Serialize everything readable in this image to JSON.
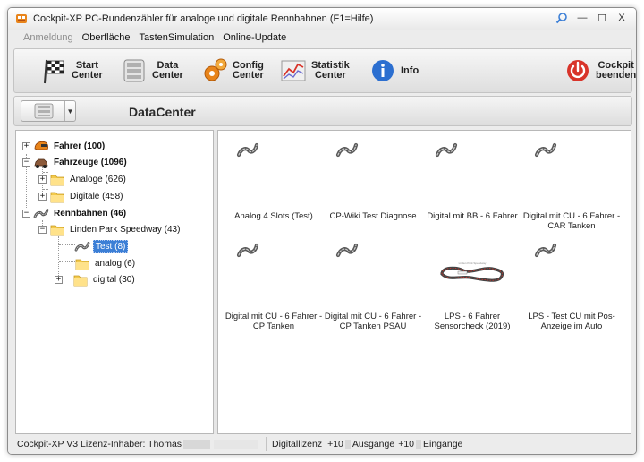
{
  "window": {
    "title": "Cockpit-XP PC-Rundenzähler für analoge und digitale Rennbahnen (F1=Hilfe)",
    "controls": {
      "minimize": "—",
      "maximize": "☐",
      "close": "X"
    }
  },
  "menu": [
    {
      "label": "Anmeldung",
      "disabled": true
    },
    {
      "label": "Oberfläche",
      "disabled": false
    },
    {
      "label": "TastenSimulation",
      "disabled": false
    },
    {
      "label": "Online-Update",
      "disabled": false
    }
  ],
  "toolbar": {
    "start": "Start\nCenter",
    "data": "Data\nCenter",
    "config": "Config\nCenter",
    "statistik": "Statistik\nCenter",
    "info": "Info",
    "exit": "Cockpit\nbeenden"
  },
  "subbar": {
    "title": "DataCenter"
  },
  "tree": {
    "fahrer": "Fahrer (100)",
    "fahrzeuge": "Fahrzeuge (1096)",
    "analoge": "Analoge (626)",
    "digitale": "Digitale (458)",
    "rennbahnen": "Rennbahnen (46)",
    "linden": "Linden Park Speedway (43)",
    "test": "Test (8)",
    "analog": "analog (6)",
    "digital": "digital (30)"
  },
  "grid": [
    {
      "label": "Analog 4 Slots (Test)",
      "thumb": false
    },
    {
      "label": "CP-Wiki Test Diagnose",
      "thumb": false
    },
    {
      "label": "Digital mit BB - 6 Fahrer",
      "thumb": false
    },
    {
      "label": "Digital mit CU - 6 Fahrer - CAR Tanken",
      "thumb": false
    },
    {
      "label": "Digital mit CU - 6 Fahrer - CP Tanken",
      "thumb": false
    },
    {
      "label": "Digital mit CU - 6 Fahrer - CP Tanken PSAU",
      "thumb": false
    },
    {
      "label": "LPS - 6 Fahrer Sensorcheck (2019)",
      "thumb": true
    },
    {
      "label": "LPS - Test CU mit Pos-Anzeige im Auto",
      "thumb": false
    }
  ],
  "status": {
    "license": "Cockpit-XP V3 Lizenz-Inhaber: Thomas",
    "digitallizenz": "Digitallizenz",
    "plus1": "+10",
    "ausgaenge": "Ausgänge",
    "plus2": "+10",
    "eingaenge": "Eingänge"
  },
  "colors": {
    "selection": "#3c7fd6",
    "accent_orange": "#e8841a",
    "exit_red": "#d8342a",
    "info_blue": "#2c6fd0"
  }
}
